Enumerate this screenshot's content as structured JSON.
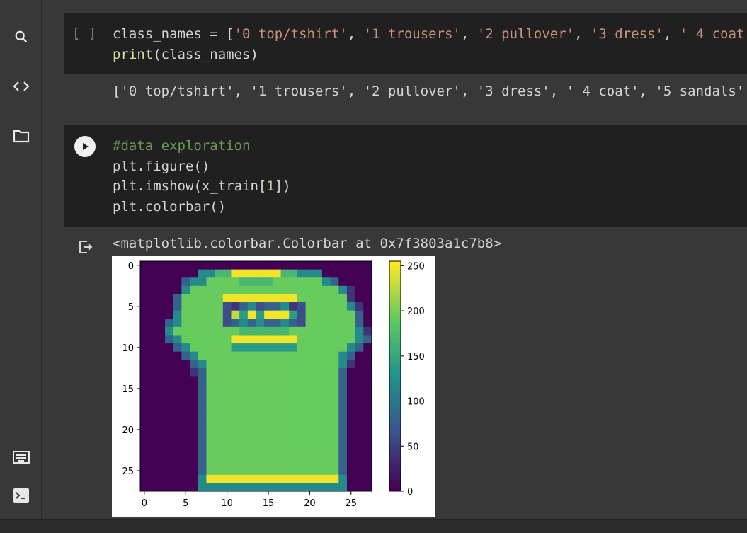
{
  "sidebar": {
    "items": [
      {
        "icon": "search-icon"
      },
      {
        "icon": "code-icon"
      },
      {
        "icon": "folder-icon"
      },
      {
        "icon": "keyboard-icon"
      },
      {
        "icon": "terminal-icon"
      }
    ]
  },
  "cell1": {
    "run_label": "[ ]",
    "line1": {
      "var": "class_names = [",
      "s1": "'0 top/tshirt'",
      "sep1": ", ",
      "s2": "'1 trousers'",
      "sep2": ", ",
      "s3": "'2 pullover'",
      "sep3": ", ",
      "s4": "'3 dress'",
      "sep4": ", ",
      "s5": "' 4 coat"
    },
    "line2_fn": "print",
    "line2_rest": "(class_names)",
    "output": "['0 top/tshirt', '1 trousers', '2 pullover', '3 dress', ' 4 coat', '5 sandals'"
  },
  "cell2": {
    "comment": "#data exploration",
    "line2": "plt.figure()",
    "line3_a": "plt.imshow(x_train[",
    "line3_num": "1",
    "line3_b": "])",
    "line4": "plt.colorbar()",
    "output_text": "<matplotlib.colorbar.Colorbar at 0x7f3803a1c7b8>"
  },
  "colors": {
    "string": "#ce9178",
    "comment": "#6a9955",
    "function": "#dcdcaa",
    "cell_bg": "#202020",
    "page_bg": "#383838"
  },
  "chart_data": {
    "type": "heatmap",
    "colormap": "viridis",
    "image_size": [
      28,
      28
    ],
    "x_ticks": [
      "0",
      "5",
      "10",
      "15",
      "20",
      "25"
    ],
    "y_ticks": [
      "0",
      "5",
      "10",
      "15",
      "20",
      "25"
    ],
    "colorbar_ticks": [
      "0",
      "50",
      "100",
      "150",
      "200",
      "250"
    ],
    "colorbar_range": [
      0,
      255
    ],
    "rows": [
      "................................",
      ".......CCEEJJJJJJEECCC..........",
      ".....BCCFFFFEEEEFFFFFFCB........",
      ".....CFFFFFFFFFFFFFFFFFFCA......",
      "....BFFFFFJJJJJJJJJFFFFFFA......",
      "....BFFFFFDABCDBBCADFFFFFCA.....",
      "....CFFFFFDIGJGJJJGDFFFFFFB.....",
      "...BCFFFFFDBCBCBBCBDFFFFFFB.....",
      "...CFFFFFFFFEEEEEEFFFFFFFFCA....",
      "...BCFFFFFFJJJJJJJJFFFFFFFCB....",
      "....BCFFFFFGGGGGGGGFFFFFFCB.....",
      ".....BCFFFFFFFFFFFFFFFFFCB......",
      "......BCFFFFFFFFFFFFFFFFCA......",
      "......ABFFFFFFFFFFFFFFFFB.......",
      ".......BFFFFFFFFFFFFFFFFB.......",
      ".......BFFFFFFFFFFFFFFFFB.......",
      ".......BFFFFFFFFFFFFFFFFB.......",
      ".......BFFFFFFFFFFFFFFFFB.......",
      ".......BFFFFFFFFFFFFFFFFB.......",
      ".......BFFFFFFFFFFFFFFFFB.......",
      ".......BFFFFFFFFFFFFFFFFB.......",
      ".......BFFFFFFFFFFFFFFFFB.......",
      ".......BFFFFFFFFFFFFFFFFB.......",
      ".......BFFFFFFFFFFFFFFFFB.......",
      ".......BFFFFFFFFFFFFFFFFB.......",
      ".......BFFFFFFFFFFFFFFFFB.......",
      ".......CJJJJJJJJJJJJJJJJC.......",
      ".......CCCCCCCCCCCCCCCCCC......."
    ],
    "levels": {
      ".": 0,
      "A": 40,
      "B": 80,
      "C": 120,
      "D": 60,
      "E": 170,
      "F": 195,
      "G": 140,
      "I": 230,
      "J": 250
    }
  }
}
